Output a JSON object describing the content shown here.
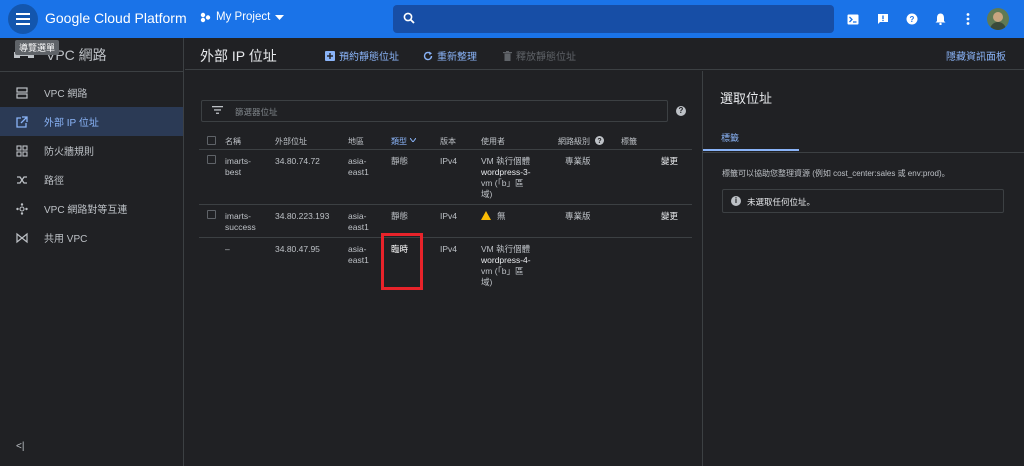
{
  "topbar": {
    "brand": "Google Cloud Platform",
    "project": "My Project",
    "menu_tooltip": "導覽選單"
  },
  "sidebar": {
    "title": "VPC 網路",
    "items": [
      {
        "label": "VPC 網路",
        "icon": "vpc-network-icon",
        "active": false
      },
      {
        "label": "外部 IP 位址",
        "icon": "external-ip-icon",
        "active": true
      },
      {
        "label": "防火牆規則",
        "icon": "firewall-icon",
        "active": false
      },
      {
        "label": "路徑",
        "icon": "routes-icon",
        "active": false
      },
      {
        "label": "VPC 網路對等互連",
        "icon": "peering-icon",
        "active": false
      },
      {
        "label": "共用 VPC",
        "icon": "shared-vpc-icon",
        "active": false
      }
    ],
    "collapse": "<|"
  },
  "subheader": {
    "title": "外部 IP 位址",
    "reserve_static": "預約靜態位址",
    "refresh": "重新整理",
    "release_static": "釋放靜態位址",
    "hide_panel": "隱藏資訊面板"
  },
  "filter": {
    "placeholder": "篩選器位址"
  },
  "table": {
    "headers": {
      "name": "名稱",
      "external": "外部位址",
      "region": "地區",
      "type": "類型",
      "version": "版本",
      "user": "使用者",
      "tier": "網路級別",
      "labels": "標籤"
    },
    "rows": [
      {
        "name": [
          "imarts-",
          "best"
        ],
        "ip": "34.80.74.72",
        "region": [
          "asia-",
          "east1"
        ],
        "type": "靜態",
        "version": "IPv4",
        "user": [
          "VM 執行個體",
          "wordpress-3-",
          "vm (「b」區",
          "域)"
        ],
        "tier": "專業版",
        "action": "變更",
        "warn": false
      },
      {
        "name": [
          "imarts-",
          "success"
        ],
        "ip": "34.80.223.193",
        "region": [
          "asia-",
          "east1"
        ],
        "type": "靜態",
        "version": "IPv4",
        "user": [
          "無"
        ],
        "tier": "專業版",
        "action": "變更",
        "warn": true
      },
      {
        "name": [
          "–"
        ],
        "ip": "34.80.47.95",
        "region": [
          "asia-",
          "east1"
        ],
        "type": "臨時",
        "version": "IPv4",
        "user": [
          "VM 執行個體",
          "wordpress-4-",
          "vm (「b」區",
          "域)"
        ],
        "tier": "",
        "action": "",
        "warn": false
      }
    ]
  },
  "right_panel": {
    "title": "選取位址",
    "tab": "標籤",
    "description": "標籤可以協助您整理資源 (例如 cost_center:sales 或 env:prod)。",
    "info": "未選取任何位址。"
  },
  "colors": {
    "topbar": "#1a73e8",
    "accent": "#8ab4f8",
    "highlight": "#e8232a"
  }
}
